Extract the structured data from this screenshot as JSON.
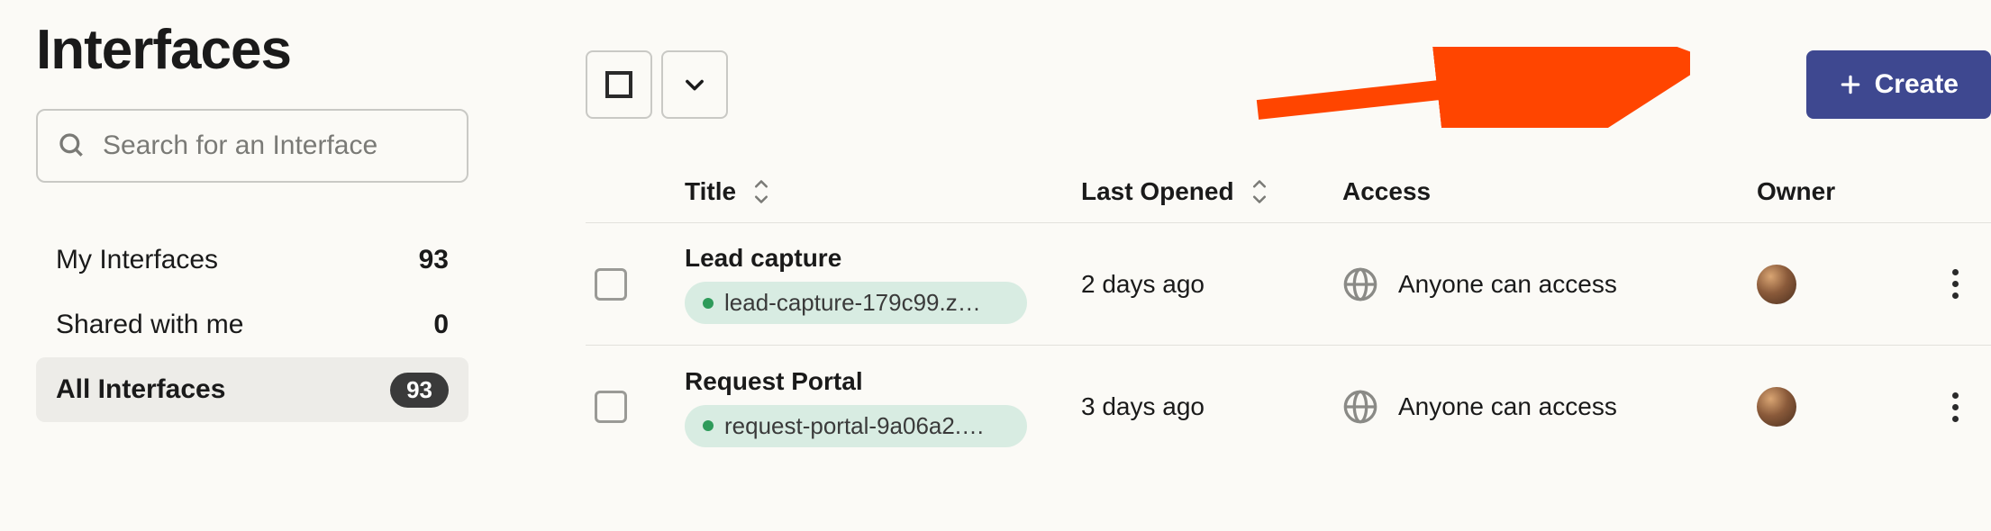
{
  "page": {
    "title": "Interfaces"
  },
  "search": {
    "placeholder": "Search for an Interface"
  },
  "sidebar": {
    "items": [
      {
        "label": "My Interfaces",
        "count": "93",
        "active": false,
        "pill": false
      },
      {
        "label": "Shared with me",
        "count": "0",
        "active": false,
        "pill": false
      },
      {
        "label": "All Interfaces",
        "count": "93",
        "active": true,
        "pill": true
      }
    ]
  },
  "toolbar": {
    "create_label": "Create"
  },
  "columns": {
    "title": "Title",
    "last_opened": "Last Opened",
    "access": "Access",
    "owner": "Owner"
  },
  "rows": [
    {
      "title": "Lead capture",
      "chip": "lead-capture-179c99.z…",
      "last_opened": "2 days ago",
      "access": "Anyone can access"
    },
    {
      "title": "Request Portal",
      "chip": "request-portal-9a06a2.…",
      "last_opened": "3 days ago",
      "access": "Anyone can access"
    }
  ],
  "colors": {
    "accent": "#3e4890",
    "arrow": "#ff4500"
  }
}
